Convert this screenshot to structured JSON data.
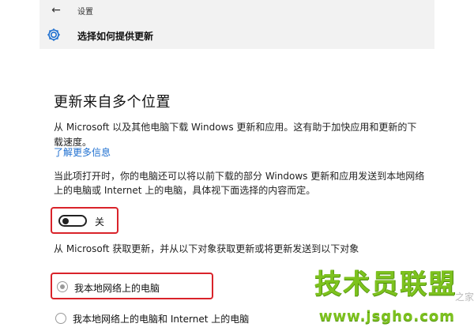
{
  "app": {
    "title": "设置",
    "page_title": "选择如何提供更新"
  },
  "main": {
    "heading": "更新来自多个位置",
    "description": "从 Microsoft 以及其他电脑下载 Windows 更新和应用。这有助于加快应用和更新的下载速度。",
    "learn_more": "了解更多信息",
    "toggle_description": "当此项打开时，你的电脑还可以将以前下载的部分 Windows 更新和应用发送到本地网络上的电脑或 Internet 上的电脑，具体视下面选择的内容而定。",
    "toggle_state_label": "关",
    "source_description": "从 Microsoft 获取更新，并从以下对象获取更新或将更新发送到以下对象",
    "options": [
      {
        "label": "我本地网络上的电脑",
        "selected": true
      },
      {
        "label": "我本地网络上的电脑和 Internet 上的电脑",
        "selected": false
      }
    ]
  },
  "watermark": {
    "brand": "技术员联盟",
    "url": "www.jsgho.com",
    "side": "之家"
  },
  "colors": {
    "highlight_border": "#d9232a",
    "link": "#1e6fd0",
    "topbar_bg": "#f2f2f2",
    "watermark": "#7dc21e"
  }
}
